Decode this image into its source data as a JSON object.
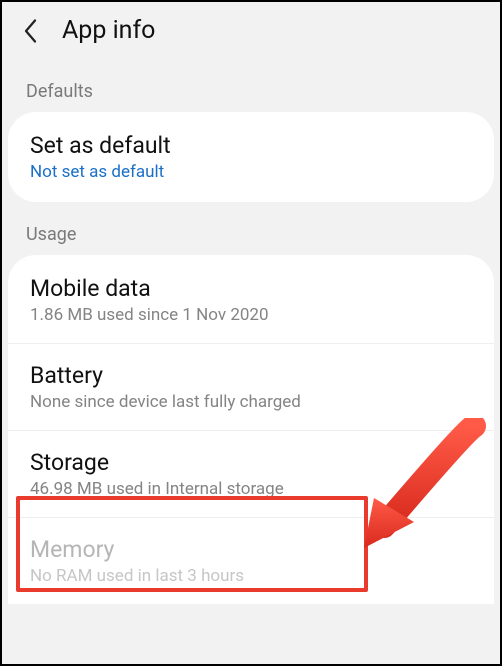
{
  "header": {
    "title": "App info"
  },
  "sections": {
    "defaults": {
      "label": "Defaults",
      "item": {
        "title": "Set as default",
        "sub": "Not set as default"
      }
    },
    "usage": {
      "label": "Usage",
      "mobile_data": {
        "title": "Mobile data",
        "sub": "1.86 MB used since 1 Nov 2020"
      },
      "battery": {
        "title": "Battery",
        "sub": "None since device last fully charged"
      },
      "storage": {
        "title": "Storage",
        "sub": "46.98 MB used in Internal storage"
      },
      "memory": {
        "title": "Memory",
        "sub": "No RAM used in last 3 hours"
      }
    }
  }
}
